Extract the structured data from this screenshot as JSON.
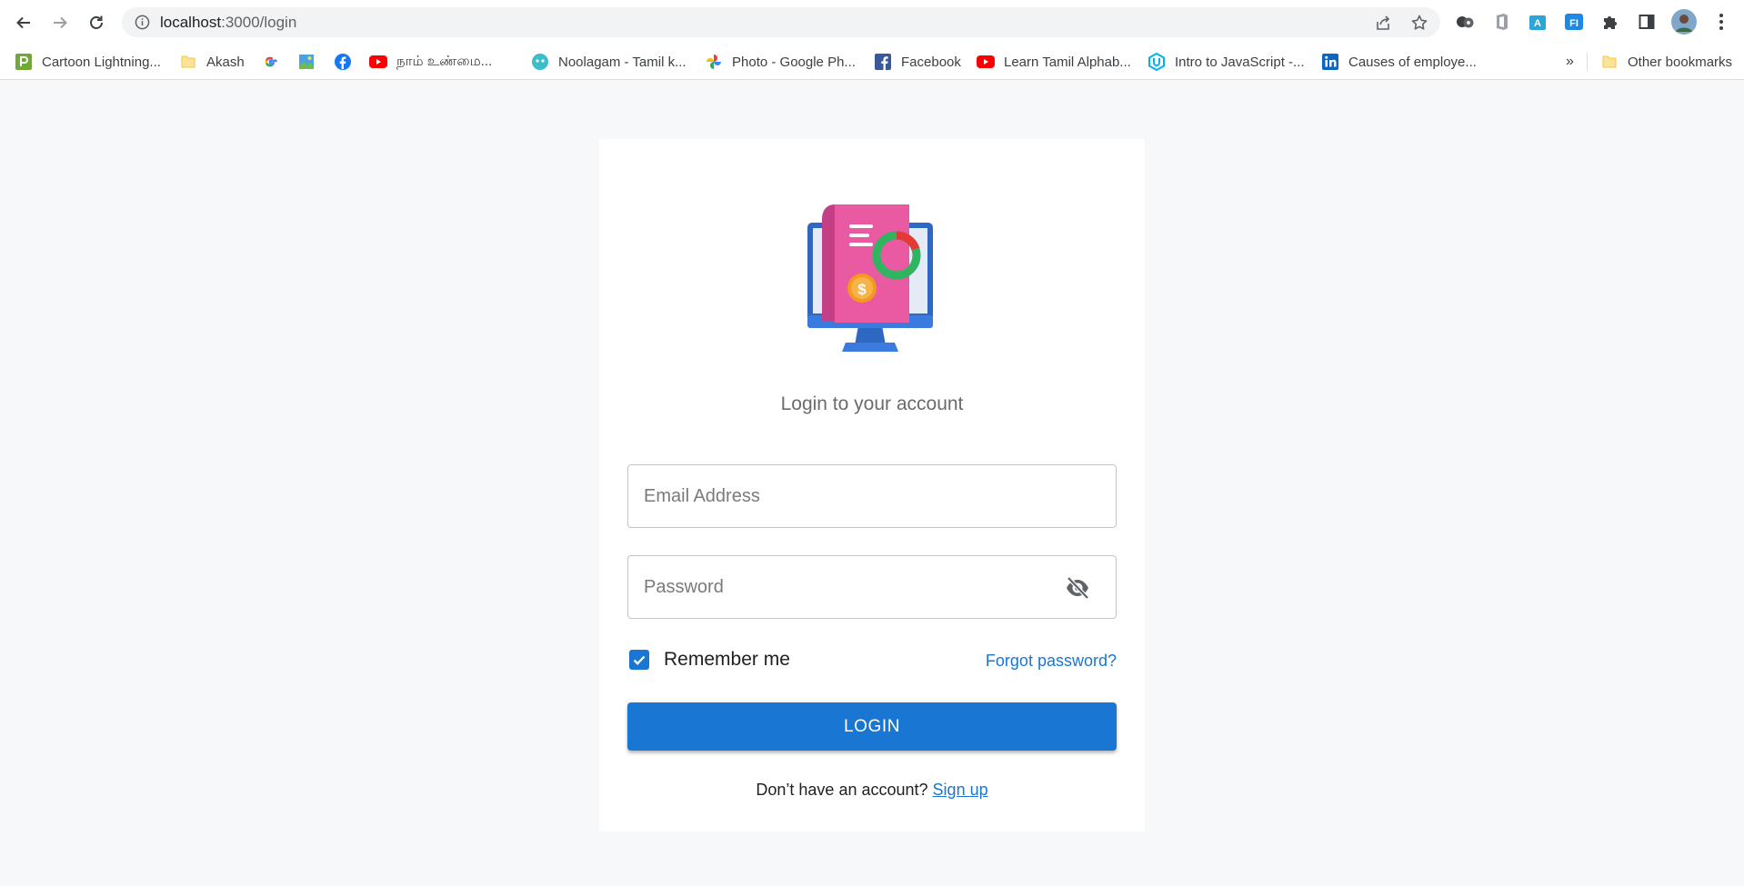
{
  "browser": {
    "url_host": "localhost",
    "url_path": ":3000/login",
    "bookmarks": [
      {
        "label": "Cartoon Lightning...",
        "icon": "pexels-icon"
      },
      {
        "label": "Akash",
        "icon": "folder-icon"
      },
      {
        "label": "",
        "icon": "google-icon"
      },
      {
        "label": "",
        "icon": "image-icon"
      },
      {
        "label": "",
        "icon": "facebook-icon"
      },
      {
        "label": "நாம் உண்மை...",
        "icon": "youtube-icon"
      },
      {
        "label": "Noolagam - Tamil k...",
        "icon": "noolagam-icon"
      },
      {
        "label": "Photo - Google Ph...",
        "icon": "google-photos-icon"
      },
      {
        "label": "Facebook",
        "icon": "facebook-square-icon"
      },
      {
        "label": "Learn Tamil Alphab...",
        "icon": "youtube-icon"
      },
      {
        "label": "Intro to JavaScript -...",
        "icon": "udacity-icon"
      },
      {
        "label": "Causes of employe...",
        "icon": "linkedin-icon"
      }
    ],
    "overflow_label": "»",
    "other_bookmarks": "Other bookmarks"
  },
  "login": {
    "subtitle": "Login to your account",
    "email_placeholder": "Email Address",
    "password_placeholder": "Password",
    "remember_label": "Remember me",
    "remember_checked": true,
    "forgot_label": "Forgot password?",
    "login_button": "LOGIN",
    "signup_prompt": "Don’t have an account?",
    "signup_link": "Sign up",
    "hero_coin_symbol": "$"
  },
  "colors": {
    "primary": "#1976d2",
    "page_bg": "#f7f8fa",
    "card_bg": "#ffffff"
  }
}
